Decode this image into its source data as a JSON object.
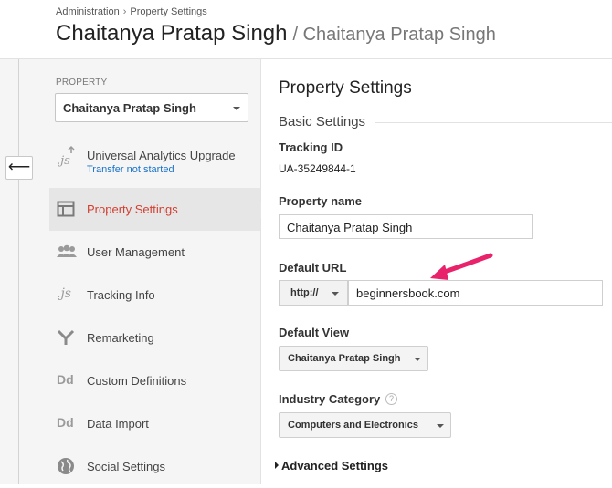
{
  "header": {
    "breadcrumb": [
      "Administration",
      "Property Settings"
    ],
    "breadcrumb_sep": "›",
    "title": "Chaitanya Pratap Singh",
    "subtitle": "/ Chaitanya Pratap Singh"
  },
  "back_button": {
    "icon": "arrow-left-icon",
    "glyph": "⟵"
  },
  "sidebar": {
    "property_label": "PROPERTY",
    "property_value": "Chaitanya Pratap Singh",
    "items": [
      {
        "label": "Universal Analytics Upgrade",
        "sub": "Transfer not started",
        "icon": "js-upload-icon",
        "glyph": ".js"
      },
      {
        "label": "Property Settings",
        "icon": "property-settings-icon",
        "active": true
      },
      {
        "label": "User Management",
        "icon": "users-icon"
      },
      {
        "label": "Tracking Info",
        "icon": "js-icon",
        "glyph": ".js"
      },
      {
        "label": "Remarketing",
        "icon": "remarketing-icon"
      },
      {
        "label": "Custom Definitions",
        "icon": "dd-icon",
        "glyph": "Dd"
      },
      {
        "label": "Data Import",
        "icon": "dd-icon",
        "glyph": "Dd"
      },
      {
        "label": "Social Settings",
        "icon": "globe-icon"
      }
    ]
  },
  "main": {
    "page_title": "Property Settings",
    "section_title": "Basic Settings",
    "tracking_id_label": "Tracking ID",
    "tracking_id_value": "UA-35249844-1",
    "property_name_label": "Property name",
    "property_name_value": "Chaitanya Pratap Singh",
    "default_url_label": "Default URL",
    "protocol_value": "http://",
    "default_url_value": "beginnersbook.com",
    "default_view_label": "Default View",
    "default_view_value": "Chaitanya Pratap Singh",
    "industry_label": "Industry Category",
    "industry_help": "?",
    "industry_value": "Computers and Electronics",
    "advanced_label": "Advanced Settings"
  },
  "colors": {
    "active_text": "#d23f31",
    "link": "#1a73c8",
    "annotation_arrow": "#e8236b",
    "sidebar_bg": "#f5f5f5",
    "active_bg": "#e6e6e6"
  }
}
